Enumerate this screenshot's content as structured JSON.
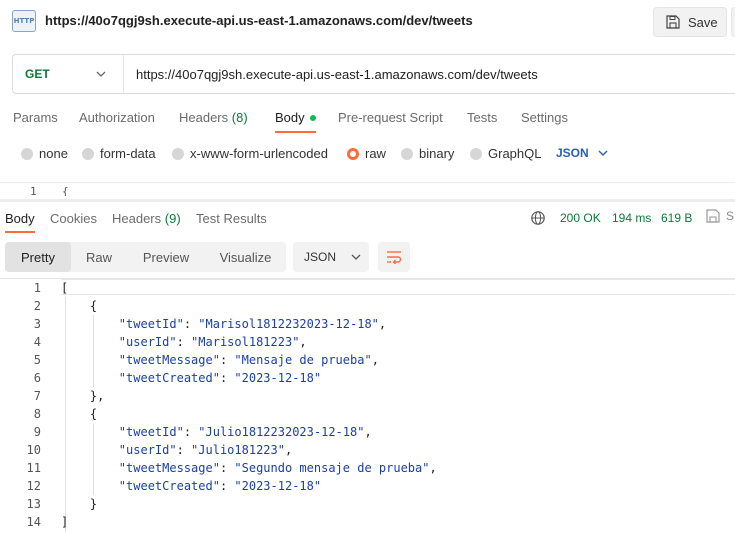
{
  "header": {
    "icon_label": "HTTP",
    "title": "https://40o7qgj9sh.execute-api.us-east-1.amazonaws.com/dev/tweets",
    "save_label": "Save"
  },
  "request": {
    "method": "GET",
    "url": "https://40o7qgj9sh.execute-api.us-east-1.amazonaws.com/dev/tweets",
    "tabs": [
      {
        "label": "Params"
      },
      {
        "label": "Authorization"
      },
      {
        "label": "Headers",
        "count": "(8)"
      },
      {
        "label": "Body",
        "active": true
      },
      {
        "label": "Pre-request Script"
      },
      {
        "label": "Tests"
      },
      {
        "label": "Settings"
      }
    ],
    "body_types": [
      "none",
      "form-data",
      "x-www-form-urlencoded",
      "raw",
      "binary",
      "GraphQL"
    ],
    "selected_body_type": "raw",
    "format": "JSON",
    "editor_line": "1",
    "editor_text": "{"
  },
  "response": {
    "tabs": [
      {
        "label": "Body",
        "active": true
      },
      {
        "label": "Cookies"
      },
      {
        "label": "Headers",
        "count": "(9)"
      },
      {
        "label": "Test Results"
      }
    ],
    "status": "200 OK",
    "time": "194 ms",
    "size": "619 B",
    "save_label": "S",
    "views": [
      "Pretty",
      "Raw",
      "Preview",
      "Visualize"
    ],
    "active_view": "Pretty",
    "format": "JSON",
    "lines": [
      {
        "n": "1",
        "text": "["
      },
      {
        "n": "2",
        "text": "    {"
      },
      {
        "n": "3",
        "key": "\"tweetId\"",
        "value": "\"Marisol1812232023-12-18\"",
        "tail": ","
      },
      {
        "n": "4",
        "key": "\"userId\"",
        "value": "\"Marisol181223\"",
        "tail": ","
      },
      {
        "n": "5",
        "key": "\"tweetMessage\"",
        "value": "\"Mensaje de prueba\"",
        "tail": ","
      },
      {
        "n": "6",
        "key": "\"tweetCreated\"",
        "value": "\"2023-12-18\"",
        "tail": ""
      },
      {
        "n": "7",
        "text": "    },"
      },
      {
        "n": "8",
        "text": "    {"
      },
      {
        "n": "9",
        "key": "\"tweetId\"",
        "value": "\"Julio1812232023-12-18\"",
        "tail": ","
      },
      {
        "n": "10",
        "key": "\"userId\"",
        "value": "\"Julio181223\"",
        "tail": ","
      },
      {
        "n": "11",
        "key": "\"tweetMessage\"",
        "value": "\"Segundo mensaje de prueba\"",
        "tail": ","
      },
      {
        "n": "12",
        "key": "\"tweetCreated\"",
        "value": "\"2023-12-18\"",
        "tail": ""
      },
      {
        "n": "13",
        "text": "    }"
      },
      {
        "n": "14",
        "text": "]"
      }
    ]
  }
}
